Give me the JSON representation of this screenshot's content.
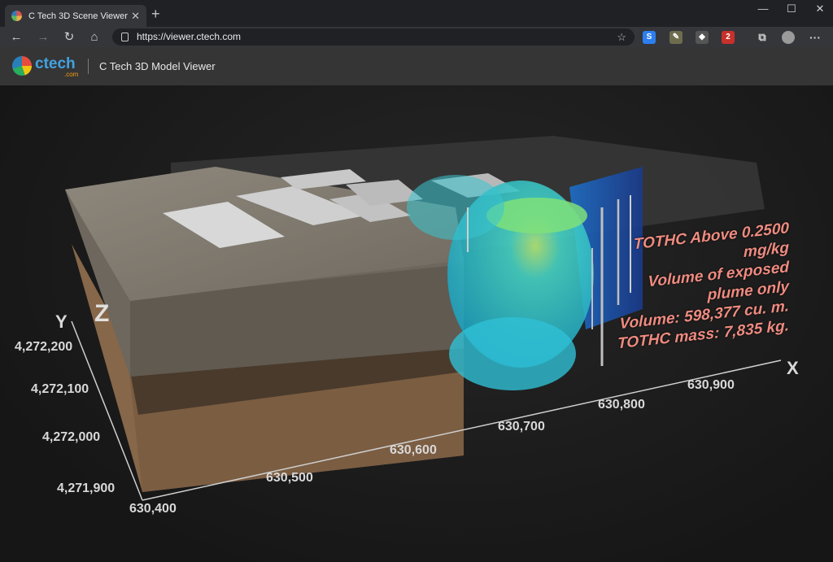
{
  "browser": {
    "tab_title": "C Tech 3D Scene Viewer",
    "url": "https://viewer.ctech.com",
    "extension_badge": "2"
  },
  "app": {
    "logo_text": "ctech",
    "logo_sub": ".com",
    "title": "C Tech 3D Model Viewer"
  },
  "annotation": {
    "line1": "TOTHC Above 0.2500 mg/kg",
    "line2": "Volume of exposed plume only",
    "line3": "Volume: 598,377 cu. m.",
    "line4": "TOTHC mass: 7,835 kg."
  },
  "axes": {
    "x_name": "X",
    "y_name": "Y",
    "z_name": "Z",
    "x_ticks": [
      "630,400",
      "630,500",
      "630,600",
      "630,700",
      "630,800",
      "630,900"
    ],
    "y_ticks": [
      "4,272,200",
      "4,272,100",
      "4,272,000",
      "4,271,900"
    ]
  },
  "colors": {
    "plume": "#3fd0dc",
    "plume_hot": "#8fe04a",
    "annotation": "#ef8b80",
    "ground_top": "#7c766c",
    "layer_dark": "#4a3a2b",
    "layer_light": "#876749"
  }
}
